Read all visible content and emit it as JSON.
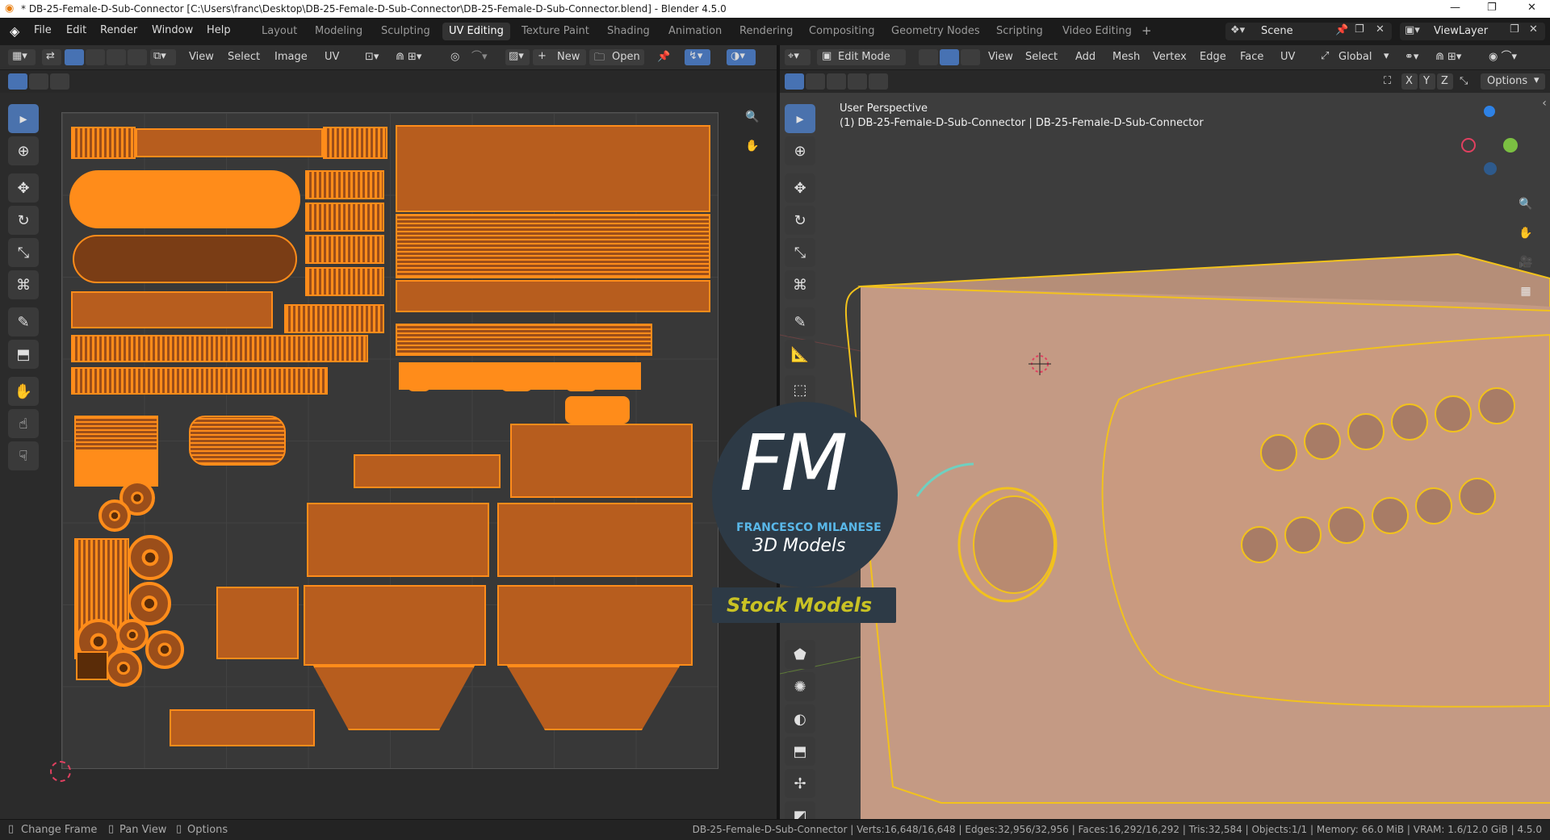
{
  "window": {
    "title": "* DB-25-Female-D-Sub-Connector [C:\\Users\\franc\\Desktop\\DB-25-Female-D-Sub-Connector\\DB-25-Female-D-Sub-Connector.blend] - Blender 4.5.0"
  },
  "menu": [
    "File",
    "Edit",
    "Render",
    "Window",
    "Help"
  ],
  "workspaces": [
    "Layout",
    "Modeling",
    "Sculpting",
    "UV Editing",
    "Texture Paint",
    "Shading",
    "Animation",
    "Rendering",
    "Compositing",
    "Geometry Nodes",
    "Scripting",
    "Video Editing"
  ],
  "active_workspace": "UV Editing",
  "scene": "Scene",
  "view_layer": "ViewLayer",
  "uv_header": {
    "view": "View",
    "select": "Select",
    "image": "Image",
    "uv": "UV",
    "new": "New",
    "open": "Open"
  },
  "viewport_header": {
    "mode": "Edit Mode",
    "view": "View",
    "select": "Select",
    "add": "Add",
    "mesh": "Mesh",
    "vertex": "Vertex",
    "edge": "Edge",
    "face": "Face",
    "uv": "UV",
    "orientation": "Global",
    "options": "Options",
    "x": "X",
    "y": "Y",
    "z": "Z"
  },
  "viewport": {
    "perspective": "User Perspective",
    "object_line": "(1) DB-25-Female-D-Sub-Connector | DB-25-Female-D-Sub-Connector"
  },
  "watermark": {
    "letters": "FM",
    "brand": "FRANCESCO MILANESE",
    "sub": "3D Models",
    "tag": "Stock Models"
  },
  "status": {
    "change_frame": "Change Frame",
    "pan_view": "Pan View",
    "options": "Options",
    "object": "DB-25-Female-D-Sub-Connector",
    "verts": "Verts:16,648/16,648",
    "edges": "Edges:32,956/32,956",
    "faces": "Faces:16,292/16,292",
    "tris": "Tris:32,584",
    "objects": "Objects:1/1",
    "memory": "Memory: 66.0 MiB",
    "vram": "VRAM: 1.6/12.0 GiB",
    "version": "4.5.0"
  },
  "colors": {
    "accent": "#4772b3",
    "uv_orange": "#ff8c1a",
    "mesh_fill": "#c49a84",
    "wire": "#f2c21c"
  }
}
